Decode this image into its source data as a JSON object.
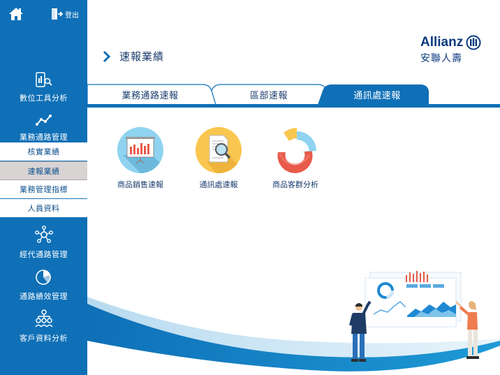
{
  "header": {
    "home_icon": "home-icon",
    "logout_label": "登出",
    "breadcrumb_title": "速報業績",
    "brand_en": "Allianz",
    "brand_zh": "安聯人壽"
  },
  "sidebar": {
    "nav": [
      {
        "label": "數位工具分析",
        "icon": "mobile-search-icon"
      },
      {
        "label": "業務通路管理",
        "icon": "trend-line-icon"
      },
      {
        "label": "經代通路管理",
        "icon": "network-icon"
      },
      {
        "label": "通路績效管理",
        "icon": "pie-chart-icon"
      },
      {
        "label": "客戶資料分析",
        "icon": "people-tree-icon"
      }
    ],
    "submenu": [
      {
        "label": "核實業績",
        "active": false
      },
      {
        "label": "速報業績",
        "active": true
      },
      {
        "label": "業務管理指標",
        "active": false
      },
      {
        "label": "人員資料",
        "active": false
      }
    ]
  },
  "tabs": [
    {
      "label": "業務通路速報",
      "active": false
    },
    {
      "label": "區部速報",
      "active": false
    },
    {
      "label": "通訊處速報",
      "active": true
    }
  ],
  "tiles": [
    {
      "label": "商品銷售速報",
      "icon": "presentation-board-icon",
      "color": "#8fd3f0"
    },
    {
      "label": "通訊處速報",
      "icon": "document-search-icon",
      "color": "#f9c74f"
    },
    {
      "label": "商品客群分析",
      "icon": "donut-chart-icon",
      "color": "#e85a4a"
    }
  ],
  "colors": {
    "sidebar": "#0f70b7",
    "active_tab": "#0f70b7",
    "accent_text": "#1a3c6e"
  }
}
